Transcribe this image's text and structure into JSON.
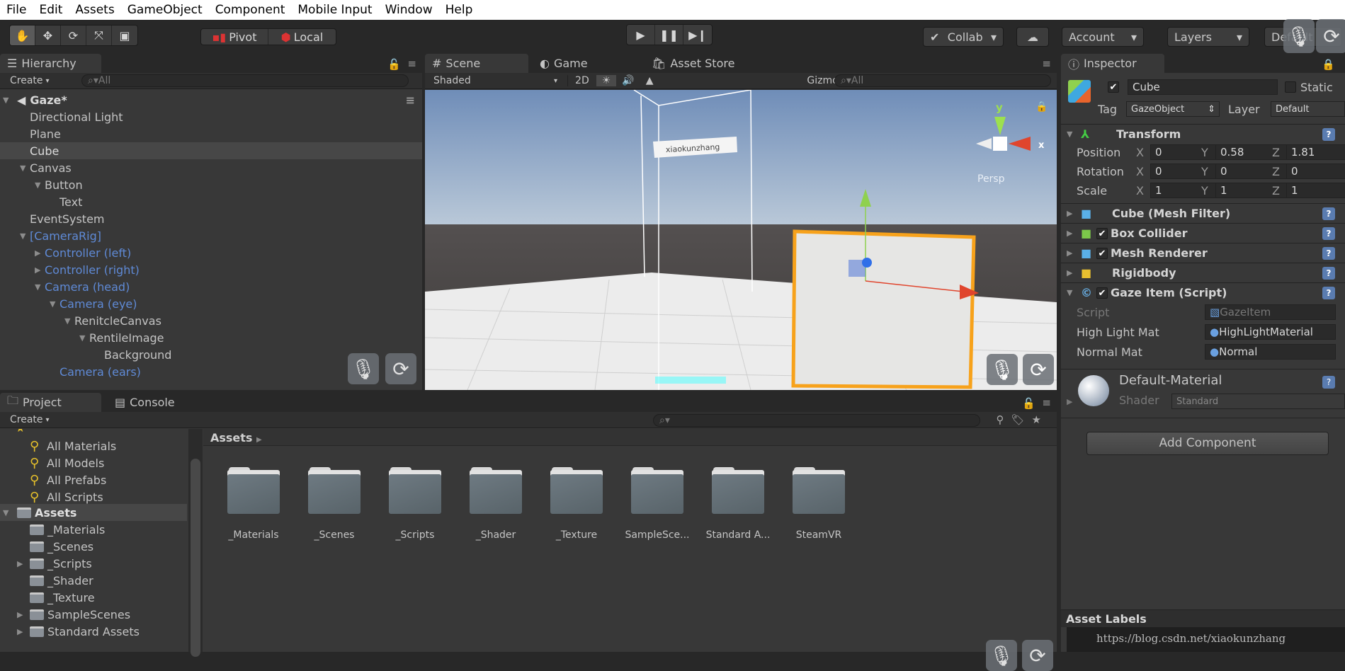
{
  "menu": [
    "File",
    "Edit",
    "Assets",
    "GameObject",
    "Component",
    "Mobile Input",
    "Window",
    "Help"
  ],
  "toolbar": {
    "tools": [
      "hand-icon",
      "move-icon",
      "rotate-icon",
      "scale-icon",
      "rect-icon"
    ],
    "pivot": "Pivot",
    "local": "Local",
    "play": [
      "play-icon",
      "pause-icon",
      "step-icon"
    ],
    "collab": "Collab",
    "account": "Account",
    "layers": "Layers",
    "layout": "Default"
  },
  "hierarchy": {
    "tab": "Hierarchy",
    "create": "Create",
    "search_placeholder": "All",
    "scene": "Gaze*",
    "items": [
      {
        "label": "Directional Light",
        "depth": 0,
        "arrow": "",
        "color": "#c4c4c4",
        "selected": false
      },
      {
        "label": "Plane",
        "depth": 0,
        "arrow": "",
        "color": "#c4c4c4",
        "selected": false
      },
      {
        "label": "Cube",
        "depth": 0,
        "arrow": "",
        "color": "#dcdcdc",
        "selected": true
      },
      {
        "label": "Canvas",
        "depth": 0,
        "arrow": "▼",
        "color": "#c4c4c4",
        "selected": false
      },
      {
        "label": "Button",
        "depth": 1,
        "arrow": "▼",
        "color": "#c4c4c4",
        "selected": false
      },
      {
        "label": "Text",
        "depth": 2,
        "arrow": "",
        "color": "#c4c4c4",
        "selected": false
      },
      {
        "label": "EventSystem",
        "depth": 0,
        "arrow": "",
        "color": "#c4c4c4",
        "selected": false
      },
      {
        "label": "[CameraRig]",
        "depth": 0,
        "arrow": "▼",
        "color": "#5f8ad6",
        "selected": false
      },
      {
        "label": "Controller (left)",
        "depth": 1,
        "arrow": "▶",
        "color": "#5f8ad6",
        "selected": false
      },
      {
        "label": "Controller (right)",
        "depth": 1,
        "arrow": "▶",
        "color": "#5f8ad6",
        "selected": false
      },
      {
        "label": "Camera (head)",
        "depth": 1,
        "arrow": "▼",
        "color": "#5f8ad6",
        "selected": false
      },
      {
        "label": "Camera (eye)",
        "depth": 2,
        "arrow": "▼",
        "color": "#5f8ad6",
        "selected": false
      },
      {
        "label": "RenitcleCanvas",
        "depth": 3,
        "arrow": "▼",
        "color": "#c4c4c4",
        "selected": false
      },
      {
        "label": "RentileImage",
        "depth": 4,
        "arrow": "▼",
        "color": "#c4c4c4",
        "selected": false
      },
      {
        "label": "Background",
        "depth": 5,
        "arrow": "",
        "color": "#c4c4c4",
        "selected": false
      },
      {
        "label": "Camera (ears)",
        "depth": 2,
        "arrow": "",
        "color": "#5f8ad6",
        "selected": false
      }
    ]
  },
  "scene": {
    "tabs": [
      "Scene",
      "Game",
      "Asset Store"
    ],
    "shading": "Shaded",
    "mode2d": "2D",
    "gizmos": "Gizmos",
    "search_placeholder": "All",
    "canvas_label": "xiaokunzhang",
    "persp": "Persp",
    "axis_y": "y",
    "axis_x": "x"
  },
  "inspector": {
    "tab": "Inspector",
    "name": "Cube",
    "active": true,
    "static_label": "Static",
    "tag_label": "Tag",
    "tag": "GazeObject",
    "layer_label": "Layer",
    "layer": "Default",
    "transform": {
      "title": "Transform",
      "rows": [
        {
          "label": "Position",
          "x": "0",
          "y": "0.58",
          "z": "1.81"
        },
        {
          "label": "Rotation",
          "x": "0",
          "y": "0",
          "z": "0"
        },
        {
          "label": "Scale",
          "x": "1",
          "y": "1",
          "z": "1"
        }
      ]
    },
    "components": [
      {
        "title": "Cube (Mesh Filter)",
        "checkbox": false,
        "icon": "mesh-filter-icon"
      },
      {
        "title": "Box Collider",
        "checkbox": true,
        "icon": "box-collider-icon"
      },
      {
        "title": "Mesh Renderer",
        "checkbox": true,
        "icon": "mesh-renderer-icon"
      },
      {
        "title": "Rigidbody",
        "checkbox": false,
        "icon": "rigidbody-icon"
      }
    ],
    "script": {
      "title": "Gaze Item (Script)",
      "fields": [
        {
          "label": "Script",
          "value": "GazeItem"
        },
        {
          "label": "High Light Mat",
          "value": "HighLightMaterial"
        },
        {
          "label": "Normal Mat",
          "value": "Normal"
        }
      ]
    },
    "material": {
      "name": "Default-Material",
      "shader_label": "Shader",
      "shader": "Standard"
    },
    "add_component": "Add Component",
    "asset_labels": "Asset Labels",
    "watermark": "https://blog.csdn.net/xiaokunzhang"
  },
  "project": {
    "tabs": [
      "Project",
      "Console"
    ],
    "create": "Create",
    "favorites": [
      "All Materials",
      "All Models",
      "All Prefabs",
      "All Scripts"
    ],
    "root": "Assets",
    "tree": [
      {
        "label": "_Materials",
        "arrow": ""
      },
      {
        "label": "_Scenes",
        "arrow": ""
      },
      {
        "label": "_Scripts",
        "arrow": "▶"
      },
      {
        "label": "_Shader",
        "arrow": ""
      },
      {
        "label": "_Texture",
        "arrow": ""
      },
      {
        "label": "SampleScenes",
        "arrow": "▶"
      },
      {
        "label": "Standard Assets",
        "arrow": "▶"
      }
    ],
    "breadcrumb": "Assets",
    "assets": [
      "_Materials",
      "_Scenes",
      "_Scripts",
      "_Shader",
      "_Texture",
      "SampleSce...",
      "Standard A...",
      "SteamVR"
    ]
  }
}
